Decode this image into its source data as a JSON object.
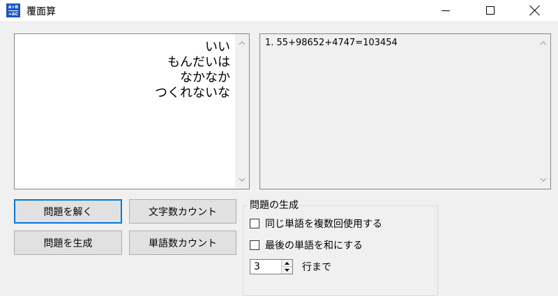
{
  "window": {
    "title": "覆面算",
    "icon_top": "A+B",
    "icon_bottom": "=AC",
    "controls": [
      "minimize-icon",
      "maximize-icon",
      "close-icon"
    ]
  },
  "puzzle_input": {
    "lines": [
      "いい",
      "もんだいは",
      "なかなか",
      "つくれないな"
    ]
  },
  "result_output": {
    "text": "1. 55+98652+4747=103454"
  },
  "buttons": {
    "solve": "問題を解く",
    "char_count": "文字数カウント",
    "generate": "問題を生成",
    "word_count": "単語数カウント"
  },
  "generation_group": {
    "title": "問題の生成",
    "reuse_words_label": "同じ単語を複数回使用する",
    "reuse_words_checked": false,
    "last_word_sum_label": "最後の単語を和にする",
    "last_word_sum_checked": false,
    "line_count_value": "3",
    "line_count_suffix": "行まで"
  },
  "colors": {
    "accent": "#0078d7",
    "icon_bg": "#1a56c5",
    "window_bg": "#f0f0f0"
  }
}
